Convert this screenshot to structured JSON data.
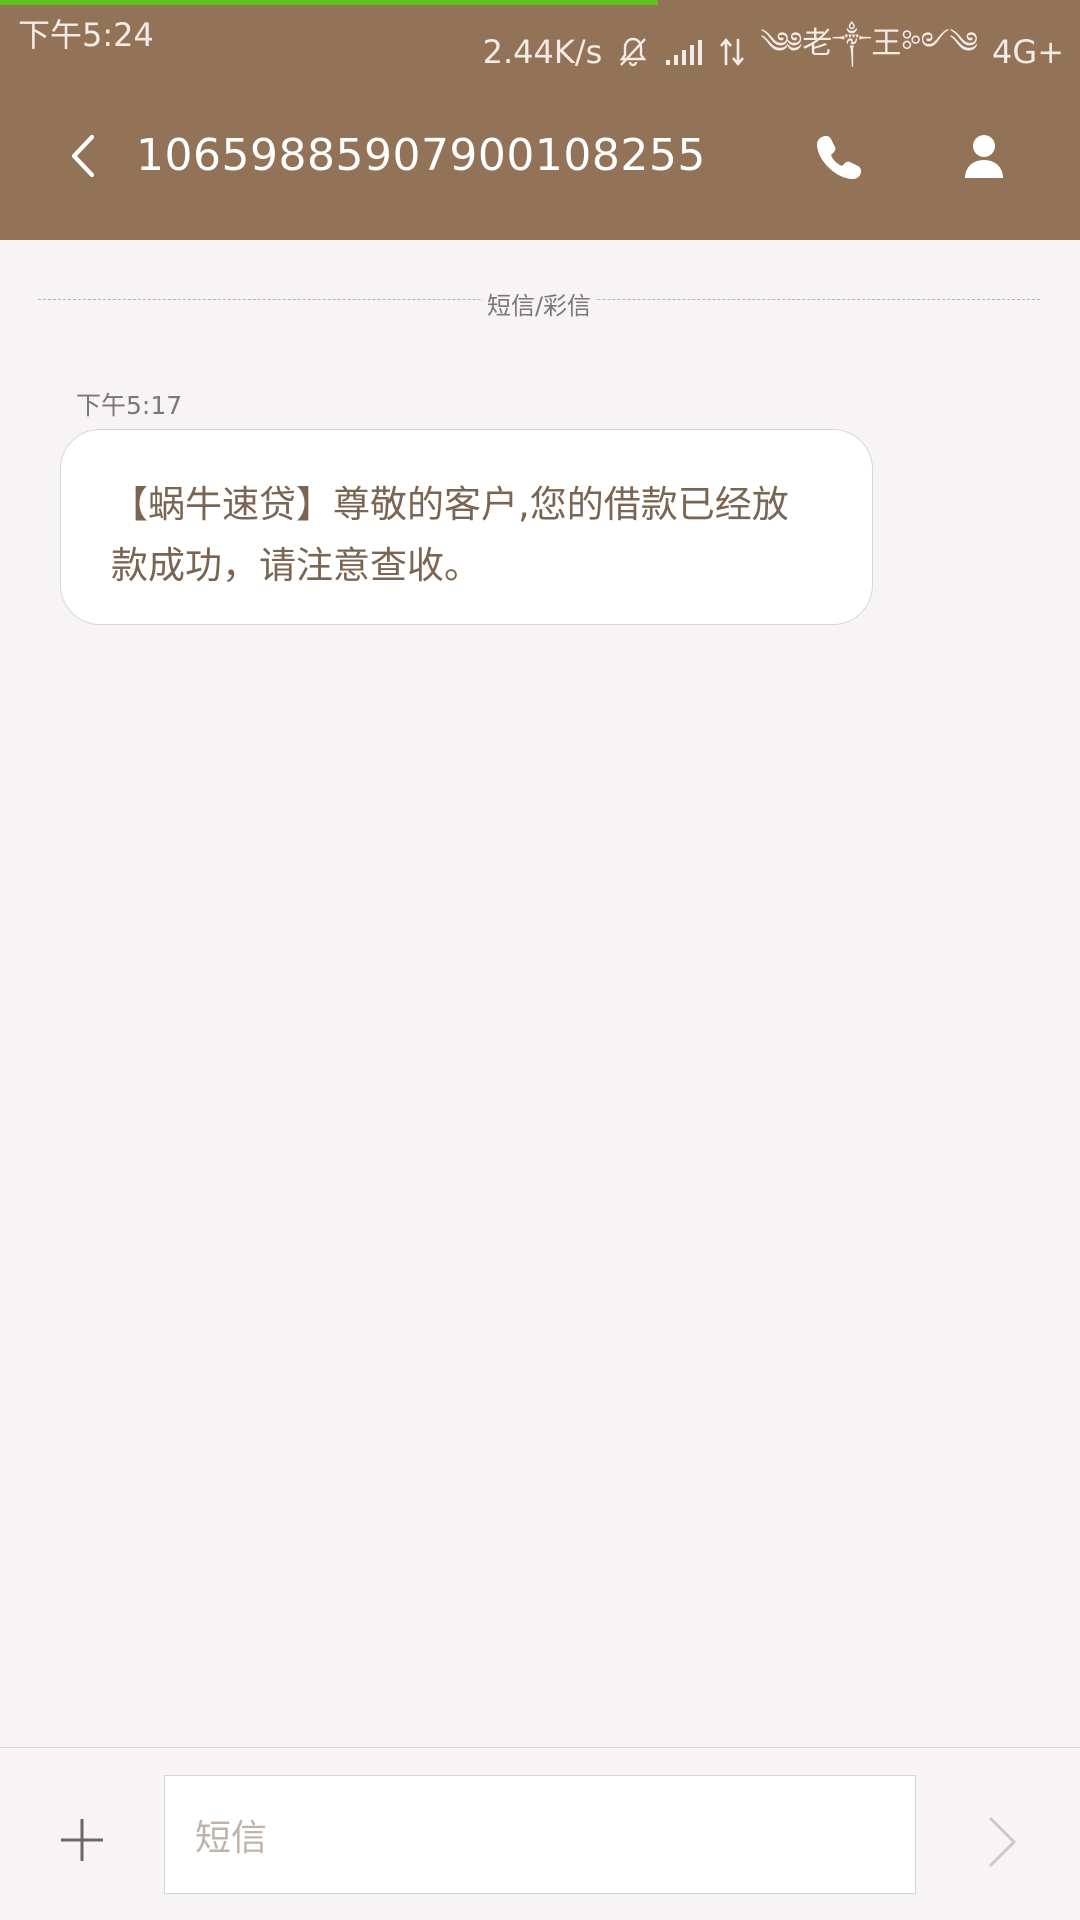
{
  "status_bar": {
    "time": "下午5:24",
    "speed": "2.44K/s",
    "carrier": "༄༅老༒王༻༄",
    "network": "4G+",
    "icons": [
      "bell-muted-icon",
      "signal-icon",
      "data-arrows-icon"
    ]
  },
  "app_bar": {
    "title": "1065988590790010825​5",
    "back_icon": "chevron-left-icon",
    "call_icon": "phone-icon",
    "contact_icon": "person-icon"
  },
  "thread": {
    "divider_label": "短信/彩信",
    "messages": [
      {
        "time": "下午5:17",
        "text": "【蜗牛速贷】尊敬的客户,您的借款已经放款成功，请注意查收。"
      }
    ]
  },
  "composer": {
    "add_icon": "plus-icon",
    "placeholder": "短信",
    "send_icon": "chevron-right-icon"
  },
  "colors": {
    "header": "#937358",
    "progress": "#5dc21e",
    "background": "#f6f4f5",
    "bubble_text": "#7a6552"
  }
}
